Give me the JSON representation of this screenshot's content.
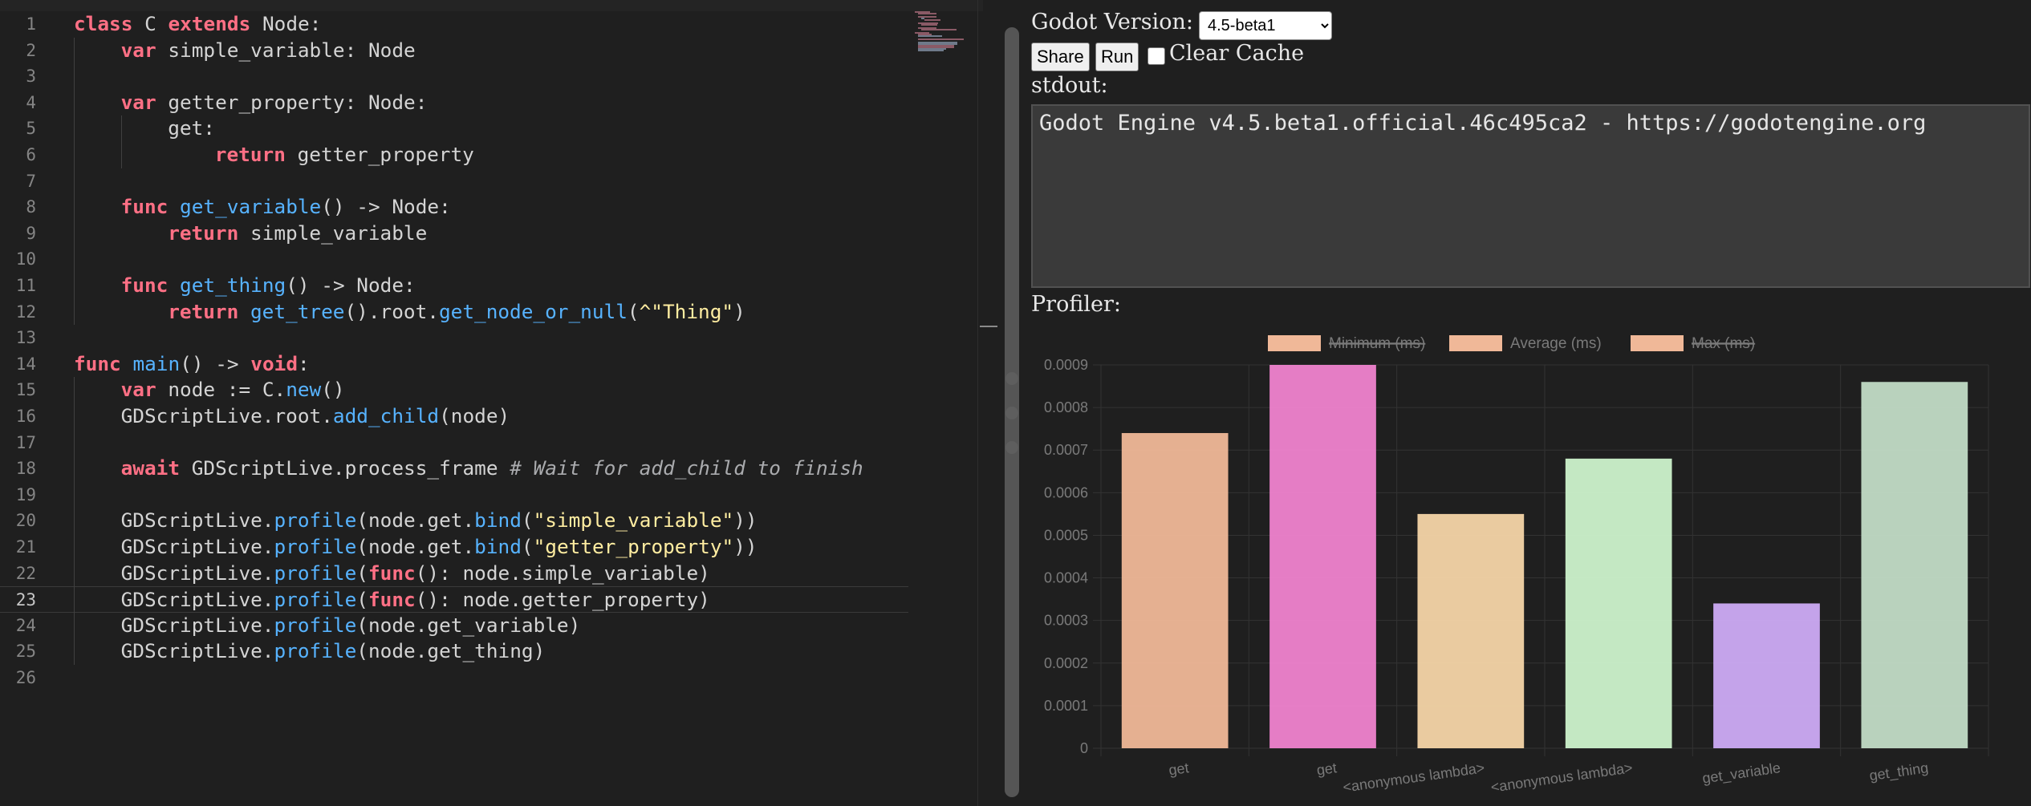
{
  "editor": {
    "lines": [
      {
        "n": "1",
        "indent": 0,
        "tokens": [
          [
            "kw",
            "class"
          ],
          [
            "pl",
            " C "
          ],
          [
            "kw",
            "extends"
          ],
          [
            "pl",
            " Node:"
          ]
        ]
      },
      {
        "n": "2",
        "indent": 1,
        "tokens": [
          [
            "kw",
            "var"
          ],
          [
            "pl",
            " simple_variable: Node"
          ]
        ]
      },
      {
        "n": "3",
        "indent": 0,
        "tokens": []
      },
      {
        "n": "4",
        "indent": 1,
        "tokens": [
          [
            "kw",
            "var"
          ],
          [
            "pl",
            " getter_property: Node:"
          ]
        ]
      },
      {
        "n": "5",
        "indent": 2,
        "tokens": [
          [
            "pl",
            "get:"
          ]
        ]
      },
      {
        "n": "6",
        "indent": 3,
        "tokens": [
          [
            "kw",
            "return"
          ],
          [
            "pl",
            " getter_property"
          ]
        ]
      },
      {
        "n": "7",
        "indent": 0,
        "tokens": []
      },
      {
        "n": "8",
        "indent": 1,
        "tokens": [
          [
            "kw",
            "func"
          ],
          [
            "pl",
            " "
          ],
          [
            "fn",
            "get_variable"
          ],
          [
            "pl",
            "() -> Node:"
          ]
        ]
      },
      {
        "n": "9",
        "indent": 2,
        "tokens": [
          [
            "kw",
            "return"
          ],
          [
            "pl",
            " simple_variable"
          ]
        ]
      },
      {
        "n": "10",
        "indent": 0,
        "tokens": []
      },
      {
        "n": "11",
        "indent": 1,
        "tokens": [
          [
            "kw",
            "func"
          ],
          [
            "pl",
            " "
          ],
          [
            "fn",
            "get_thing"
          ],
          [
            "pl",
            "() -> Node:"
          ]
        ]
      },
      {
        "n": "12",
        "indent": 2,
        "tokens": [
          [
            "kw",
            "return"
          ],
          [
            "pl",
            " "
          ],
          [
            "fn",
            "get_tree"
          ],
          [
            "pl",
            "().root."
          ],
          [
            "fn",
            "get_node_or_null"
          ],
          [
            "pl",
            "("
          ],
          [
            "str",
            "^\"Thing\""
          ],
          [
            "pl",
            ")"
          ]
        ]
      },
      {
        "n": "13",
        "indent": 0,
        "tokens": []
      },
      {
        "n": "14",
        "indent": 0,
        "tokens": [
          [
            "kw",
            "func"
          ],
          [
            "pl",
            " "
          ],
          [
            "fn",
            "main"
          ],
          [
            "pl",
            "() -> "
          ],
          [
            "kw",
            "void"
          ],
          [
            "pl",
            ":"
          ]
        ]
      },
      {
        "n": "15",
        "indent": 1,
        "tokens": [
          [
            "kw",
            "var"
          ],
          [
            "pl",
            " node := C."
          ],
          [
            "fn",
            "new"
          ],
          [
            "pl",
            "()"
          ]
        ]
      },
      {
        "n": "16",
        "indent": 1,
        "tokens": [
          [
            "pl",
            "GDScriptLive.root."
          ],
          [
            "fn",
            "add_child"
          ],
          [
            "pl",
            "(node)"
          ]
        ]
      },
      {
        "n": "17",
        "indent": 0,
        "tokens": []
      },
      {
        "n": "18",
        "indent": 1,
        "tokens": [
          [
            "kw",
            "await"
          ],
          [
            "pl",
            " GDScriptLive.process_frame "
          ],
          [
            "cmt",
            "# Wait for add_child to finish"
          ]
        ]
      },
      {
        "n": "19",
        "indent": 0,
        "tokens": []
      },
      {
        "n": "20",
        "indent": 1,
        "tokens": [
          [
            "pl",
            "GDScriptLive."
          ],
          [
            "fn",
            "profile"
          ],
          [
            "pl",
            "(node.get."
          ],
          [
            "fn",
            "bind"
          ],
          [
            "pl",
            "("
          ],
          [
            "str",
            "\"simple_variable\""
          ],
          [
            "pl",
            "))"
          ]
        ]
      },
      {
        "n": "21",
        "indent": 1,
        "tokens": [
          [
            "pl",
            "GDScriptLive."
          ],
          [
            "fn",
            "profile"
          ],
          [
            "pl",
            "(node.get."
          ],
          [
            "fn",
            "bind"
          ],
          [
            "pl",
            "("
          ],
          [
            "str",
            "\"getter_property\""
          ],
          [
            "pl",
            "))"
          ]
        ]
      },
      {
        "n": "22",
        "indent": 1,
        "tokens": [
          [
            "pl",
            "GDScriptLive."
          ],
          [
            "fn",
            "profile"
          ],
          [
            "pl",
            "("
          ],
          [
            "kw",
            "func"
          ],
          [
            "pl",
            "(): node.simple_variable)"
          ]
        ]
      },
      {
        "n": "23",
        "indent": 1,
        "tokens": [
          [
            "pl",
            "GDScriptLive."
          ],
          [
            "fn",
            "profile"
          ],
          [
            "pl",
            "("
          ],
          [
            "kw",
            "func"
          ],
          [
            "pl",
            "(): node.getter_property)"
          ]
        ]
      },
      {
        "n": "24",
        "indent": 1,
        "tokens": [
          [
            "pl",
            "GDScriptLive."
          ],
          [
            "fn",
            "profile"
          ],
          [
            "pl",
            "(node.get_variable)"
          ]
        ]
      },
      {
        "n": "25",
        "indent": 1,
        "tokens": [
          [
            "pl",
            "GDScriptLive."
          ],
          [
            "fn",
            "profile"
          ],
          [
            "pl",
            "(node.get_thing)"
          ]
        ]
      },
      {
        "n": "26",
        "indent": 0,
        "tokens": []
      }
    ],
    "current_line": "23",
    "colors": {
      "keyword": "#ff7085",
      "function": "#57b3ff",
      "string": "#ffeda1",
      "comment": "#cdcfd2",
      "text": "#d4d4d4"
    }
  },
  "panel": {
    "version_label": "Godot Version:",
    "version_selected": "4.5-beta1",
    "share_label": "Share",
    "run_label": "Run",
    "clear_cache_label": "Clear Cache",
    "clear_cache_checked": false,
    "stdout_label": "stdout:",
    "stdout_text": "Godot Engine v4.5.beta1.official.46c495ca2 - https://godotengine.org",
    "profiler_label": "Profiler:"
  },
  "chart_data": {
    "type": "bar",
    "legend": [
      {
        "label": "Minimum (ms)",
        "hidden": true
      },
      {
        "label": "Average (ms)",
        "hidden": false
      },
      {
        "label": "Max (ms)",
        "hidden": true
      }
    ],
    "legend_position": "top-center",
    "categories": [
      "get",
      "get",
      "<anonymous lambda>",
      "<anonymous lambda>",
      "get_variable",
      "get_thing"
    ],
    "series": [
      {
        "name": "Average (ms)",
        "values": [
          0.00074,
          0.0009,
          0.00055,
          0.00068,
          0.00034,
          0.00086
        ]
      }
    ],
    "bar_colors": [
      "#f0b898",
      "#f083cf",
      "#f5d5a8",
      "#cef3cc",
      "#cdabf5",
      "#c2dcc6"
    ],
    "yticks": [
      "0",
      "0.0001",
      "0.0002",
      "0.0003",
      "0.0004",
      "0.0005",
      "0.0006",
      "0.0007",
      "0.0008",
      "0.0009"
    ],
    "ylim": [
      0,
      0.0009
    ],
    "grid": true
  }
}
